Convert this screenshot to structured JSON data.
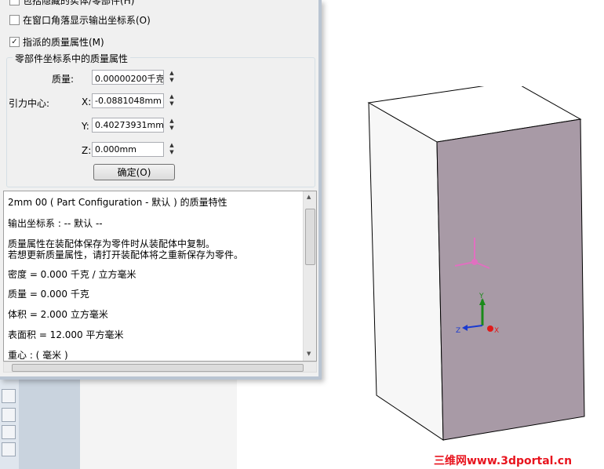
{
  "dialog": {
    "top_clipped": "包括隐藏的实体/零部件(H)",
    "check_corner": {
      "label": "在窗口角落显示输出坐标系(O)",
      "checked": false
    },
    "check_assigned": {
      "label": "指派的质量属性(M)",
      "checked": true
    },
    "group_title": "零部件坐标系中的质量属性",
    "mass_label": "质量:",
    "mass_value": "0.00000200千克",
    "cog_label": "引力中心:",
    "x_label": "X:",
    "x_value": "-0.0881048mm",
    "y_label": "Y:",
    "y_value": "0.40273931mm",
    "z_label": "Z:",
    "z_value": "0.000mm",
    "ok_button": "确定(O)"
  },
  "results": {
    "lines": [
      "2mm 00 ( Part Configuration - 默认 ) 的质量特性",
      "输出坐标系 : -- 默认 --",
      "质量属性在装配体保存为零件时从装配体中复制。",
      "若想更新质量属性，请打开装配体将之重新保存为零件。",
      "密度 = 0.000 千克 /  立方毫米",
      "质量 = 0.000 千克",
      "体积 = 2.000  立方毫米",
      "表面积 = 12.000  平方毫米",
      "重心 : ( 毫米 )"
    ]
  },
  "viewport": {
    "triad_labels": {
      "x": "X",
      "y": "Y",
      "z": "Z"
    },
    "box_front_color": "#a89aa6",
    "box_top_color": "#ffffff",
    "box_side_color": "#f7f7f7"
  },
  "watermark": "三维网www.3dportal.cn"
}
